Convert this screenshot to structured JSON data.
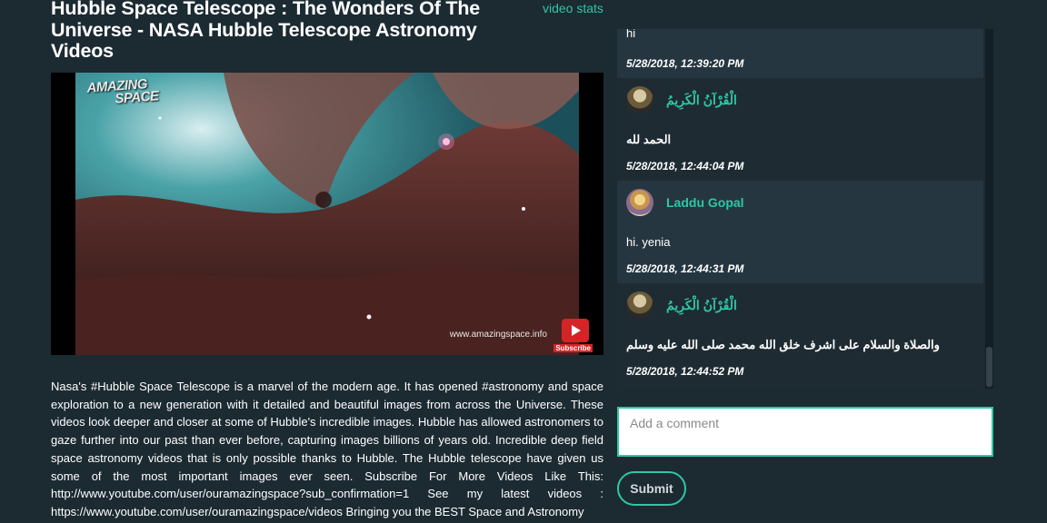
{
  "video": {
    "title": "Hubble Space Telescope : The Wonders Of The Universe - NASA Hubble Telescope Astronomy Videos",
    "stats_link": "video stats",
    "logo_line1": "AMAZING",
    "logo_line2": "SPACE",
    "watermark": "www.amazingspace.info",
    "subscribe_badge": "Subscribe",
    "description": "Nasa's #Hubble Space Telescope is a marvel of the modern age. It has opened #astronomy and space exploration to a new generation with it detailed and beautiful images from across the Universe. These videos look deeper and closer at some of Hubble's incredible images. Hubble has allowed astronomers to gaze further into our past than ever before, capturing images billions of years old. Incredible deep field space astronomy videos that is only possible thanks to Hubble. The Hubble telescope have given us some of the most important images ever seen. Subscribe For More Videos Like This: http://www.youtube.com/user/ouramazingspace?sub_confirmation=1 See my latest videos : https://www.youtube.com/user/ouramazingspace/videos Bringing you the BEST Space and Astronomy"
  },
  "comments": [
    {
      "text": "hi",
      "time": "5/28/2018, 12:39:20 PM"
    },
    {
      "user": "الْقُرْآنُ الْكَرِيمُ",
      "text": "الحمد لله",
      "time": "5/28/2018, 12:44:04 PM"
    },
    {
      "user": "Laddu Gopal",
      "text": "hi. yenia",
      "time": "5/28/2018, 12:44:31 PM"
    },
    {
      "user": "الْقُرْآنُ الْكَرِيمُ",
      "text": "والصلاة والسلام على اشرف خلق الله محمد صلى الله عليه وسلم",
      "time": "5/28/2018, 12:44:52 PM"
    }
  ],
  "form": {
    "placeholder": "Add a comment",
    "submit_label": "Submit"
  },
  "colors": {
    "background": "#1c2a32",
    "accent": "#2ec7a6"
  }
}
